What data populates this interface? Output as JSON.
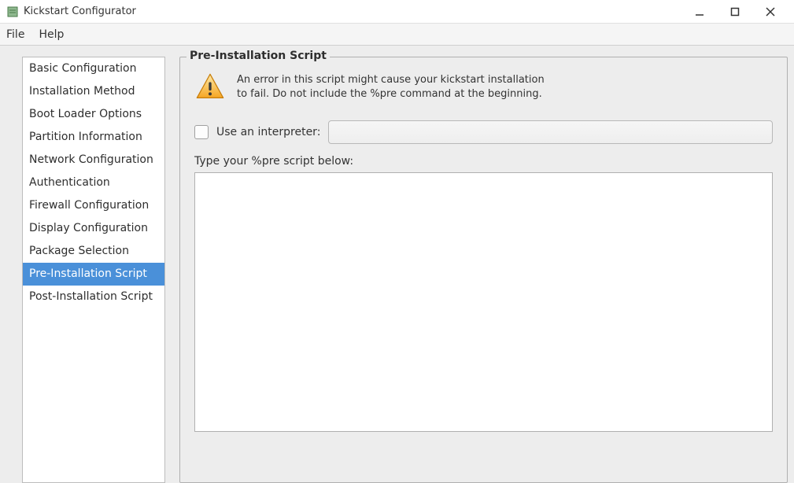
{
  "window": {
    "title": "Kickstart Configurator"
  },
  "menubar": {
    "items": [
      "File",
      "Help"
    ]
  },
  "sidebar": {
    "items": [
      "Basic Configuration",
      "Installation Method",
      "Boot Loader Options",
      "Partition Information",
      "Network Configuration",
      "Authentication",
      "Firewall Configuration",
      "Display Configuration",
      "Package Selection",
      "Pre-Installation Script",
      "Post-Installation Script"
    ],
    "selected_index": 9
  },
  "panel": {
    "title": "Pre-Installation Script",
    "warning_line1": "An error in this script might cause your kickstart installation",
    "warning_line2": "to fail. Do not include the %pre command at the beginning.",
    "interpreter_checkbox_label": "Use an interpreter:",
    "interpreter_checked": false,
    "interpreter_value": "",
    "script_label": "Type your %pre script below:",
    "script_value": ""
  }
}
